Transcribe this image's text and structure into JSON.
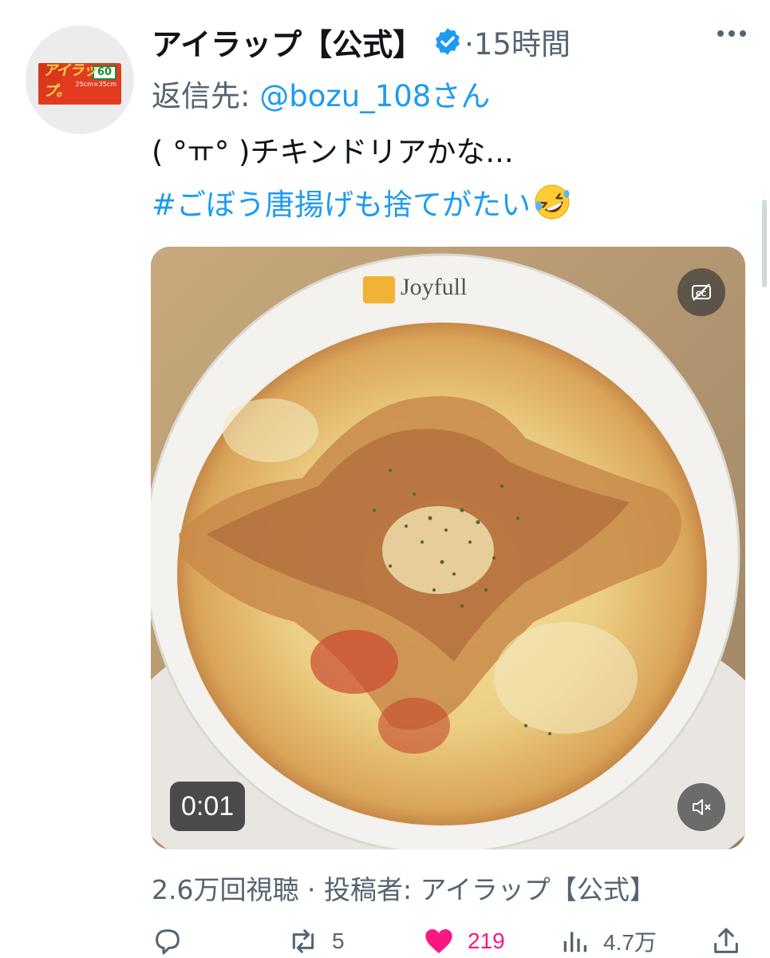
{
  "tweet": {
    "author_name": "アイラップ【公式】",
    "separator_time": "·15時間",
    "reply_label": "返信先: ",
    "reply_handle": "@bozu_108さん",
    "text_line1": "( °ㅠ° )チキンドリアかな...",
    "hashtag": "#ごぼう唐揚げも捨てがたい",
    "emoji_icon": "rolling-on-floor-laughing-emoji"
  },
  "avatar": {
    "count_label": "60",
    "size_label": "25cm×35cm",
    "logo_text": "アイラップ。"
  },
  "media": {
    "plate_brand": "Joyfull",
    "elapsed_time": "0:01",
    "cc_icon": "captions-off-icon",
    "mute_icon": "muted-speaker-icon"
  },
  "views_line": "2.6万回視聴 · 投稿者: アイラップ【公式】",
  "actions": {
    "reply_count": "",
    "retweet_count": "5",
    "like_count": "219",
    "views_count": "4.7万"
  },
  "colors": {
    "accent": "#1d9bf0",
    "like": "#f91880",
    "muted_text": "#536471"
  }
}
